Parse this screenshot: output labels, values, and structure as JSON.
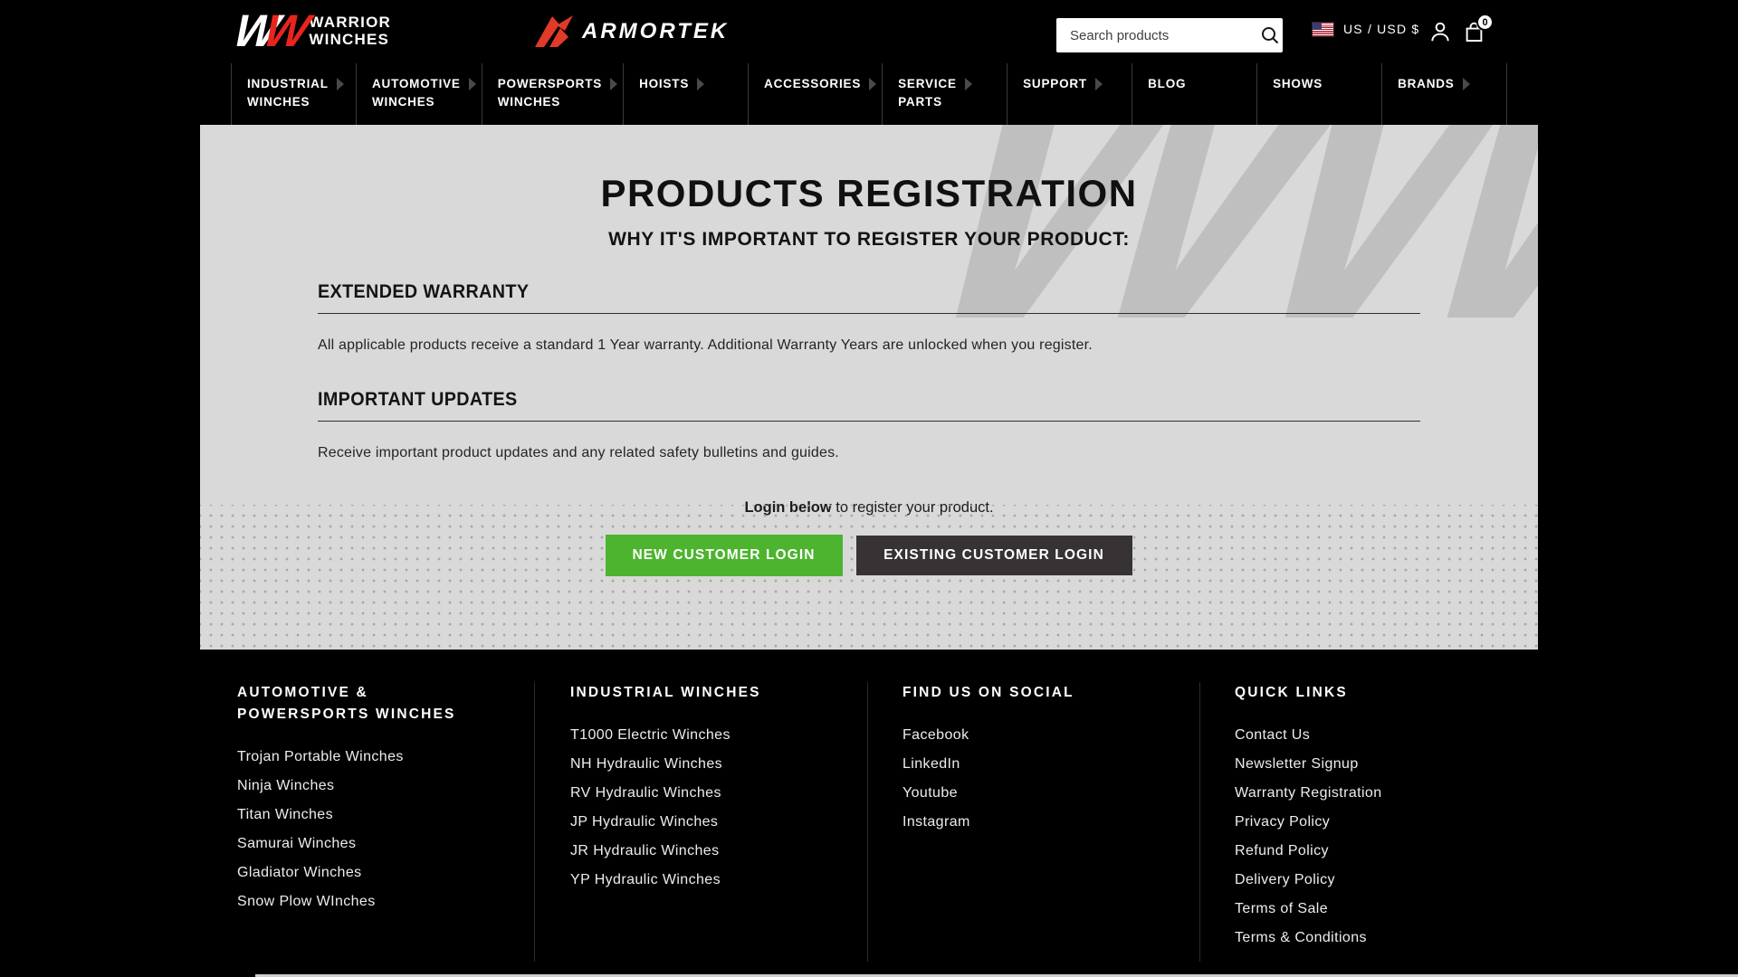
{
  "header": {
    "warrior_logo": {
      "mark_w1": "W",
      "mark_w2": "W",
      "line1": "WARRIOR",
      "line2": "WINCHES"
    },
    "armortek_logo": {
      "text": "ARMORTEK"
    },
    "search": {
      "placeholder": "Search products"
    },
    "locale": {
      "label": "US / USD $"
    },
    "cart": {
      "count": "0"
    }
  },
  "nav": {
    "items": [
      {
        "label": "INDUSTRIAL WINCHES"
      },
      {
        "label": "AUTOMOTIVE WINCHES"
      },
      {
        "label": "POWERSPORTS WINCHES"
      },
      {
        "label": "HOISTS"
      },
      {
        "label": "ACCESSORIES"
      },
      {
        "label": "SERVICE PARTS"
      },
      {
        "label": "SUPPORT"
      },
      {
        "label": "BLOG"
      },
      {
        "label": "SHOWS"
      },
      {
        "label": "BRANDS"
      }
    ]
  },
  "main": {
    "watermark_text": "WW",
    "title": "PRODUCTS REGISTRATION",
    "subtitle": "WHY IT'S IMPORTANT TO REGISTER YOUR PRODUCT:",
    "sections": [
      {
        "heading": "EXTENDED WARRANTY",
        "body": "All applicable products receive a standard 1 Year warranty. Additional Warranty Years are unlocked when you register."
      },
      {
        "heading": "IMPORTANT UPDATES",
        "body": "Receive important product updates and any related safety bulletins and guides."
      }
    ],
    "login_prompt": {
      "bold": "Login below",
      "rest": " to register your product."
    },
    "buttons": {
      "new_customer": "NEW CUSTOMER LOGIN",
      "existing_customer": "EXISTING CUSTOMER LOGIN"
    }
  },
  "footer": {
    "columns": [
      {
        "heading": "AUTOMOTIVE & POWERSPORTS WINCHES",
        "links": [
          "Trojan Portable Winches",
          "Ninja Winches",
          "Titan Winches",
          "Samurai Winches",
          "Gladiator Winches",
          "Snow Plow WInches"
        ]
      },
      {
        "heading": "INDUSTRIAL WINCHES",
        "links": [
          "T1000 Electric Winches",
          "NH Hydraulic Winches",
          "RV Hydraulic Winches",
          "JP Hydraulic Winches",
          "JR Hydraulic Winches",
          "YP Hydraulic Winches"
        ]
      },
      {
        "heading": "FIND US ON SOCIAL",
        "links": [
          "Facebook",
          "LinkedIn",
          "Youtube",
          "Instagram"
        ]
      },
      {
        "heading": "QUICK LINKS",
        "links": [
          "Contact Us",
          "Newsletter Signup",
          "Warranty Registration",
          "Privacy Policy",
          "Refund Policy",
          "Delivery Policy",
          "Terms of Sale",
          "Terms & Conditions"
        ]
      }
    ]
  },
  "colors": {
    "accent_green": "#4db42f",
    "accent_red": "#e8251d",
    "content_bg": "#d9d9d9",
    "dark_button": "#373334",
    "page_bg": "#000000"
  }
}
